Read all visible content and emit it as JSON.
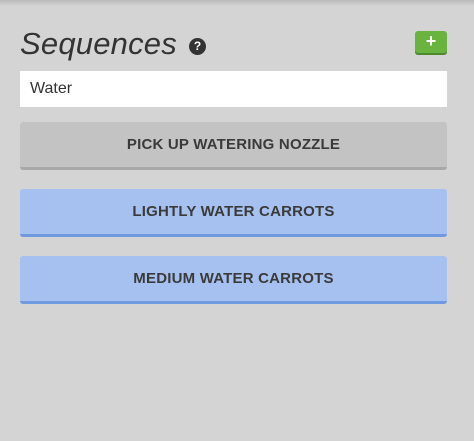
{
  "panel": {
    "title": "Sequences",
    "help_icon": "?",
    "add_button_icon": "+"
  },
  "search": {
    "value": "Water"
  },
  "sequences": [
    {
      "label": "PICK UP WATERING NOZZLE",
      "color": "#c3c3c3"
    },
    {
      "label": "LIGHTLY WATER CARROTS",
      "color": "#a6c1f0"
    },
    {
      "label": "MEDIUM WATER CARROTS",
      "color": "#a6c1f0"
    }
  ],
  "colors": {
    "add_button": "#69b33f",
    "sequence_blue": "#a6c1f0",
    "sequence_gray": "#c3c3c3"
  }
}
